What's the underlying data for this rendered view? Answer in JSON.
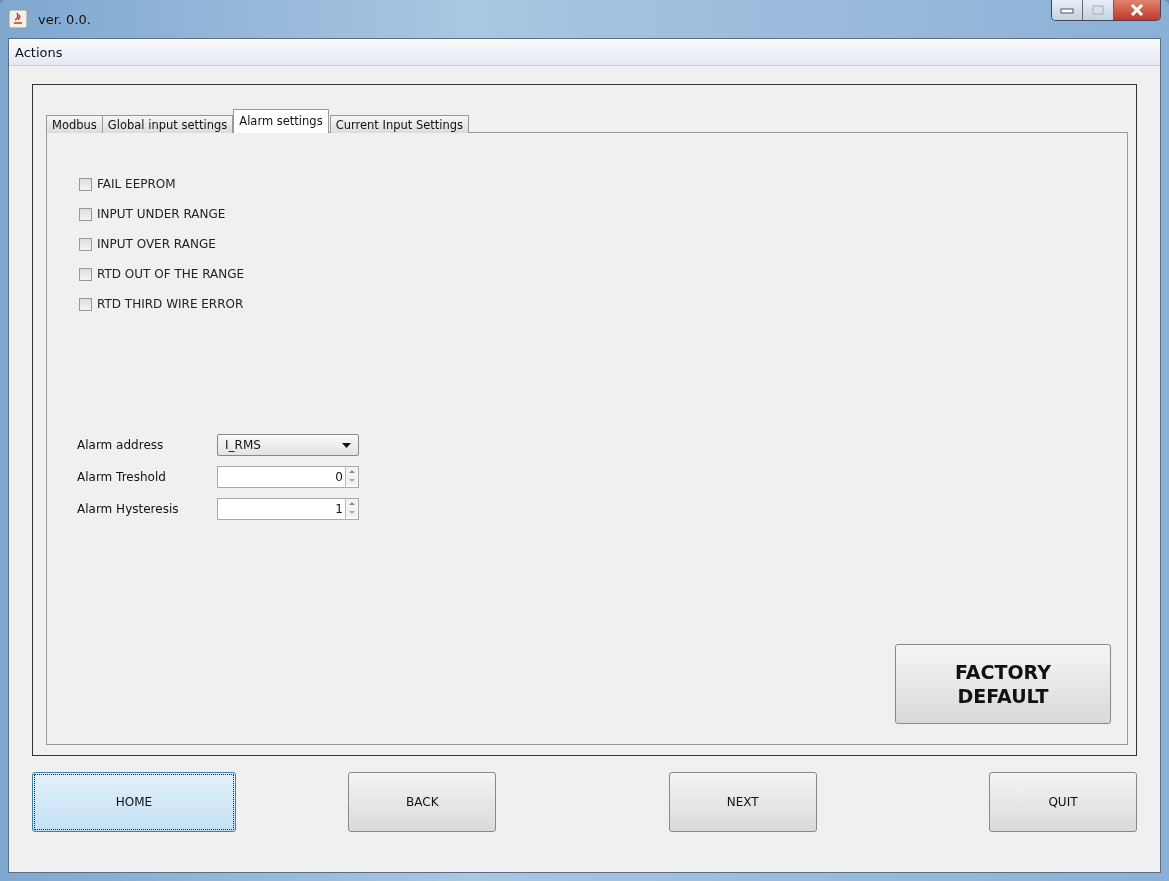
{
  "window": {
    "title": "ver. 0.0."
  },
  "menu": [
    {
      "label": "Actions"
    }
  ],
  "tabs": [
    {
      "label": "Modbus",
      "selected": false
    },
    {
      "label": "Global input settings",
      "selected": false
    },
    {
      "label": "Alarm settings",
      "selected": true
    },
    {
      "label": "Current Input Settings",
      "selected": false
    }
  ],
  "alarms": [
    {
      "label": "FAIL EEPROM",
      "checked": false
    },
    {
      "label": "INPUT UNDER RANGE",
      "checked": false
    },
    {
      "label": "INPUT OVER RANGE",
      "checked": false
    },
    {
      "label": "RTD OUT OF THE RANGE",
      "checked": false
    },
    {
      "label": "RTD THIRD WIRE ERROR",
      "checked": false
    }
  ],
  "fields": [
    {
      "kind": "dropdown",
      "label": "Alarm address",
      "value": "I_RMS"
    },
    {
      "kind": "spinner",
      "label": "Alarm Treshold",
      "value": "0"
    },
    {
      "kind": "spinner",
      "label": "Alarm Hysteresis",
      "value": "1"
    }
  ],
  "factory_button": {
    "lines": [
      "FACTORY",
      "DEFAULT"
    ]
  },
  "nav_buttons": [
    {
      "label": "HOME",
      "focused": true
    },
    {
      "label": "BACK",
      "focused": false
    },
    {
      "label": "NEXT",
      "focused": false
    },
    {
      "label": "QUIT",
      "focused": false
    }
  ]
}
